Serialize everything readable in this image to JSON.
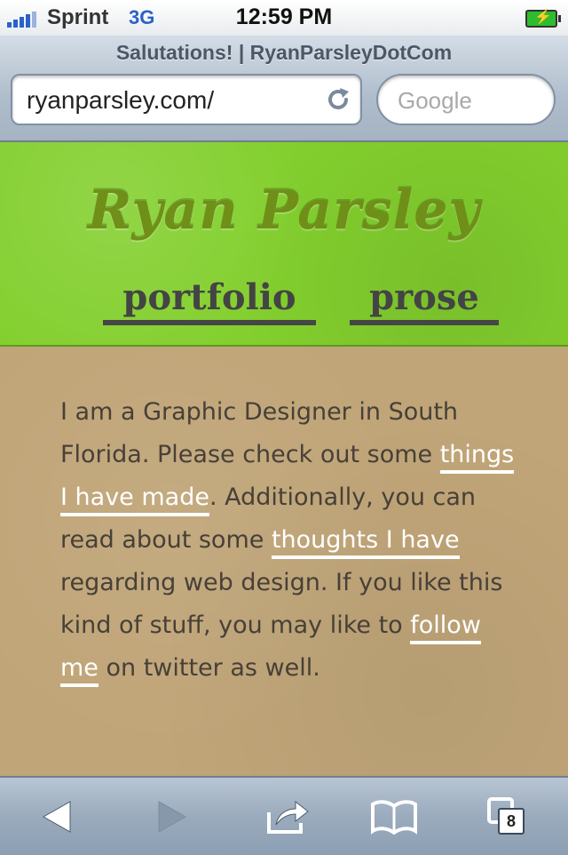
{
  "status_bar": {
    "carrier": "Sprint",
    "network": "3G",
    "time": "12:59 PM",
    "battery_icon": "charging-battery-icon"
  },
  "browser": {
    "page_title": "Salutations! | RyanParsleyDotCom",
    "url": "ryanparsley.com/",
    "search_placeholder": "Google",
    "tab_count": "8"
  },
  "site": {
    "title": "Ryan Parsley",
    "nav": [
      {
        "label": "portfolio"
      },
      {
        "label": "prose"
      }
    ],
    "intro": {
      "text_1": "I am a Graphic Designer in South Florida. Please check out some ",
      "link_1": "things I have made",
      "text_2": ". Additionally, you can read about some ",
      "link_2": "thoughts I have",
      "text_3": " regarding web design. If you like this kind of stuff, you may like to ",
      "link_3": "follow me",
      "text_4": " on twitter as well."
    }
  },
  "colors": {
    "header_green": "#83cf2e",
    "content_tan": "#c0a578",
    "link_white": "#ffffff",
    "ios_blue": "#2a62c9"
  }
}
